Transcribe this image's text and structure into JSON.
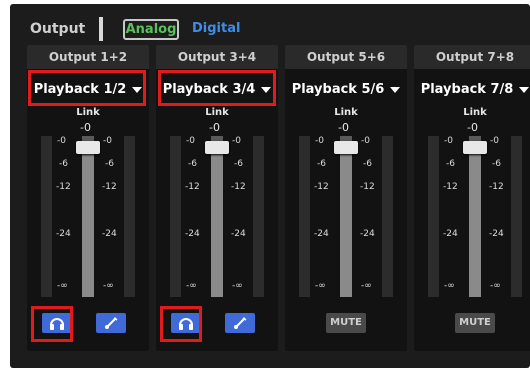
{
  "header": {
    "title": "Output",
    "tabs": [
      {
        "label": "Analog",
        "active": true
      },
      {
        "label": "Digital",
        "active": false
      }
    ]
  },
  "strips": [
    {
      "name": "Output 1+2",
      "source": "Playback 1/2",
      "link_label": "Link",
      "fader_value": "-0",
      "scale": [
        "-0",
        "-6",
        "-12",
        "-24",
        "-∞"
      ],
      "buttons": [
        "headphones-icon",
        "instrument-icon"
      ],
      "highlighted": true
    },
    {
      "name": "Output 3+4",
      "source": "Playback 3/4",
      "link_label": "Link",
      "fader_value": "-0",
      "scale": [
        "-0",
        "-6",
        "-12",
        "-24",
        "-∞"
      ],
      "buttons": [
        "headphones-icon",
        "instrument-icon"
      ],
      "highlighted": true
    },
    {
      "name": "Output 5+6",
      "source": "Playback 5/6",
      "link_label": "Link",
      "fader_value": "-0",
      "scale": [
        "-0",
        "-6",
        "-12",
        "-24",
        "-∞"
      ],
      "mute_label": "MUTE",
      "highlighted": false
    },
    {
      "name": "Output 7+8",
      "source": "Playback 7/8",
      "link_label": "Link",
      "fader_value": "-0",
      "scale": [
        "-0",
        "-6",
        "-12",
        "-24",
        "-∞"
      ],
      "mute_label": "MUTE",
      "highlighted": false
    }
  ],
  "colors": {
    "analog_tab": "#5cc05c",
    "digital_tab": "#3f8ee6",
    "button_blue": "#3f6ad8",
    "highlight": "#e01b1b"
  }
}
